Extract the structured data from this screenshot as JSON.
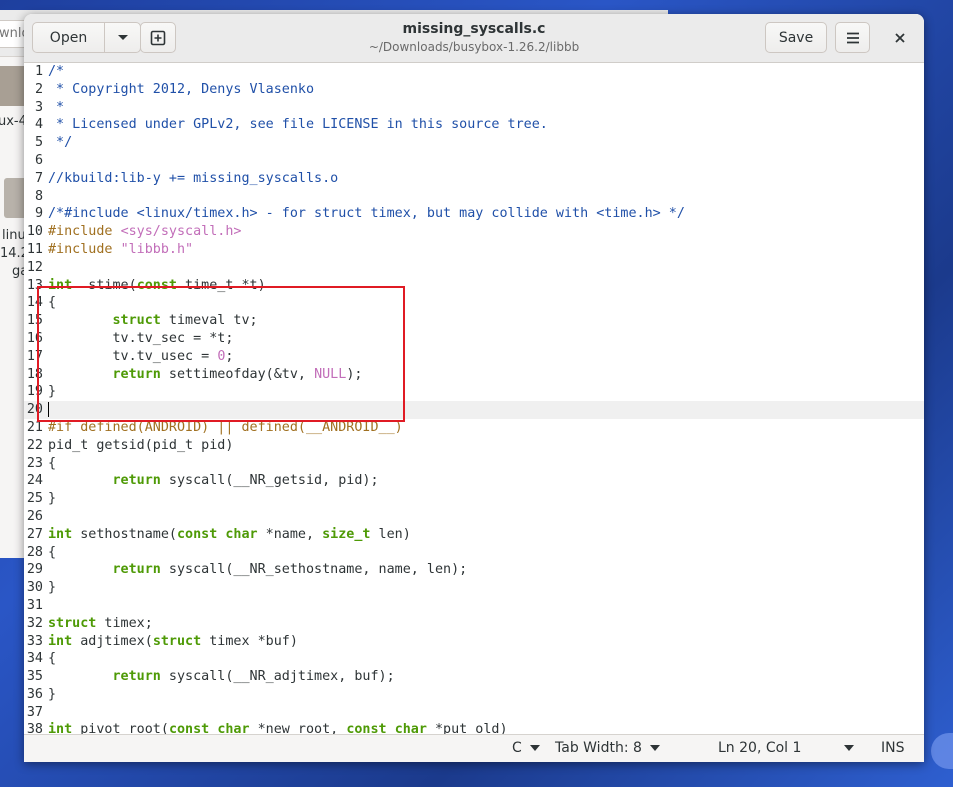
{
  "background": {
    "path_fragment": "wnlo",
    "labels": [
      "ux-4",
      "linu",
      "14.2",
      "ga"
    ]
  },
  "header": {
    "open_label": "Open",
    "title": "missing_syscalls.c",
    "subtitle": "~/Downloads/busybox-1.26.2/libbb",
    "save_label": "Save"
  },
  "status": {
    "language": "C",
    "tab_width": "Tab Width: 8",
    "position": "Ln 20, Col 1",
    "mode": "INS"
  },
  "lines": [
    {
      "n": "1",
      "segs": [
        [
          "c",
          "/*"
        ]
      ]
    },
    {
      "n": "2",
      "segs": [
        [
          "c",
          " * Copyright 2012, Denys Vlasenko"
        ]
      ]
    },
    {
      "n": "3",
      "segs": [
        [
          "c",
          " *"
        ]
      ]
    },
    {
      "n": "4",
      "segs": [
        [
          "c",
          " * Licensed under GPLv2, see file LICENSE in this source tree."
        ]
      ]
    },
    {
      "n": "5",
      "segs": [
        [
          "c",
          " */"
        ]
      ]
    },
    {
      "n": "6",
      "segs": []
    },
    {
      "n": "7",
      "segs": [
        [
          "c",
          "//kbuild:lib-y += missing_syscalls.o"
        ]
      ]
    },
    {
      "n": "8",
      "segs": []
    },
    {
      "n": "9",
      "segs": [
        [
          "c",
          "/*#include <linux/timex.h> - for struct timex, but may collide with <time.h> */"
        ]
      ]
    },
    {
      "n": "10",
      "segs": [
        [
          "pp",
          "#include "
        ],
        [
          "str",
          "<sys/syscall.h>"
        ]
      ]
    },
    {
      "n": "11",
      "segs": [
        [
          "pp",
          "#include "
        ],
        [
          "str",
          "\"libbb.h\""
        ]
      ]
    },
    {
      "n": "12",
      "segs": []
    },
    {
      "n": "13",
      "segs": [
        [
          "t",
          "int"
        ],
        [
          "",
          "  stime("
        ],
        [
          "k",
          "const"
        ],
        [
          "",
          " time_t *t)"
        ]
      ]
    },
    {
      "n": "14",
      "segs": [
        [
          "",
          "{"
        ]
      ]
    },
    {
      "n": "15",
      "segs": [
        [
          "",
          "        "
        ],
        [
          "k",
          "struct"
        ],
        [
          "",
          " timeval tv;"
        ]
      ]
    },
    {
      "n": "16",
      "segs": [
        [
          "",
          "        tv.tv_sec = *t;"
        ]
      ]
    },
    {
      "n": "17",
      "segs": [
        [
          "",
          "        tv.tv_usec = "
        ],
        [
          "num",
          "0"
        ],
        [
          "",
          ";"
        ]
      ]
    },
    {
      "n": "18",
      "segs": [
        [
          "",
          "        "
        ],
        [
          "k",
          "return"
        ],
        [
          "",
          " settimeofday(&tv, "
        ],
        [
          "str",
          "NULL"
        ],
        [
          "",
          ");"
        ]
      ]
    },
    {
      "n": "19",
      "segs": [
        [
          "",
          "}"
        ]
      ]
    },
    {
      "n": "20",
      "segs": [],
      "current": true
    },
    {
      "n": "21",
      "segs": [
        [
          "pp",
          "#if defined(ANDROID) || defined(__ANDROID__)"
        ]
      ]
    },
    {
      "n": "22",
      "segs": [
        [
          "",
          "pid_t getsid(pid_t pid)"
        ]
      ]
    },
    {
      "n": "23",
      "segs": [
        [
          "",
          "{"
        ]
      ]
    },
    {
      "n": "24",
      "segs": [
        [
          "",
          "        "
        ],
        [
          "k",
          "return"
        ],
        [
          "",
          " syscall(__NR_getsid, pid);"
        ]
      ]
    },
    {
      "n": "25",
      "segs": [
        [
          "",
          "}"
        ]
      ]
    },
    {
      "n": "26",
      "segs": []
    },
    {
      "n": "27",
      "segs": [
        [
          "t",
          "int"
        ],
        [
          "",
          " sethostname("
        ],
        [
          "k",
          "const"
        ],
        [
          "",
          " "
        ],
        [
          "t",
          "char"
        ],
        [
          "",
          " *name, "
        ],
        [
          "t",
          "size_t"
        ],
        [
          "",
          " len)"
        ]
      ]
    },
    {
      "n": "28",
      "segs": [
        [
          "",
          "{"
        ]
      ]
    },
    {
      "n": "29",
      "segs": [
        [
          "",
          "        "
        ],
        [
          "k",
          "return"
        ],
        [
          "",
          " syscall(__NR_sethostname, name, len);"
        ]
      ]
    },
    {
      "n": "30",
      "segs": [
        [
          "",
          "}"
        ]
      ]
    },
    {
      "n": "31",
      "segs": []
    },
    {
      "n": "32",
      "segs": [
        [
          "k",
          "struct"
        ],
        [
          "",
          " timex;"
        ]
      ]
    },
    {
      "n": "33",
      "segs": [
        [
          "t",
          "int"
        ],
        [
          "",
          " adjtimex("
        ],
        [
          "k",
          "struct"
        ],
        [
          "",
          " timex *buf)"
        ]
      ]
    },
    {
      "n": "34",
      "segs": [
        [
          "",
          "{"
        ]
      ]
    },
    {
      "n": "35",
      "segs": [
        [
          "",
          "        "
        ],
        [
          "k",
          "return"
        ],
        [
          "",
          " syscall(__NR_adjtimex, buf);"
        ]
      ]
    },
    {
      "n": "36",
      "segs": [
        [
          "",
          "}"
        ]
      ]
    },
    {
      "n": "37",
      "segs": []
    },
    {
      "n": "38",
      "segs": [
        [
          "t",
          "int"
        ],
        [
          "",
          " pivot_root("
        ],
        [
          "k",
          "const"
        ],
        [
          "",
          " "
        ],
        [
          "t",
          "char"
        ],
        [
          "",
          " *new_root, "
        ],
        [
          "k",
          "const"
        ],
        [
          "",
          " "
        ],
        [
          "t",
          "char"
        ],
        [
          "",
          " *put_old)"
        ]
      ]
    }
  ]
}
